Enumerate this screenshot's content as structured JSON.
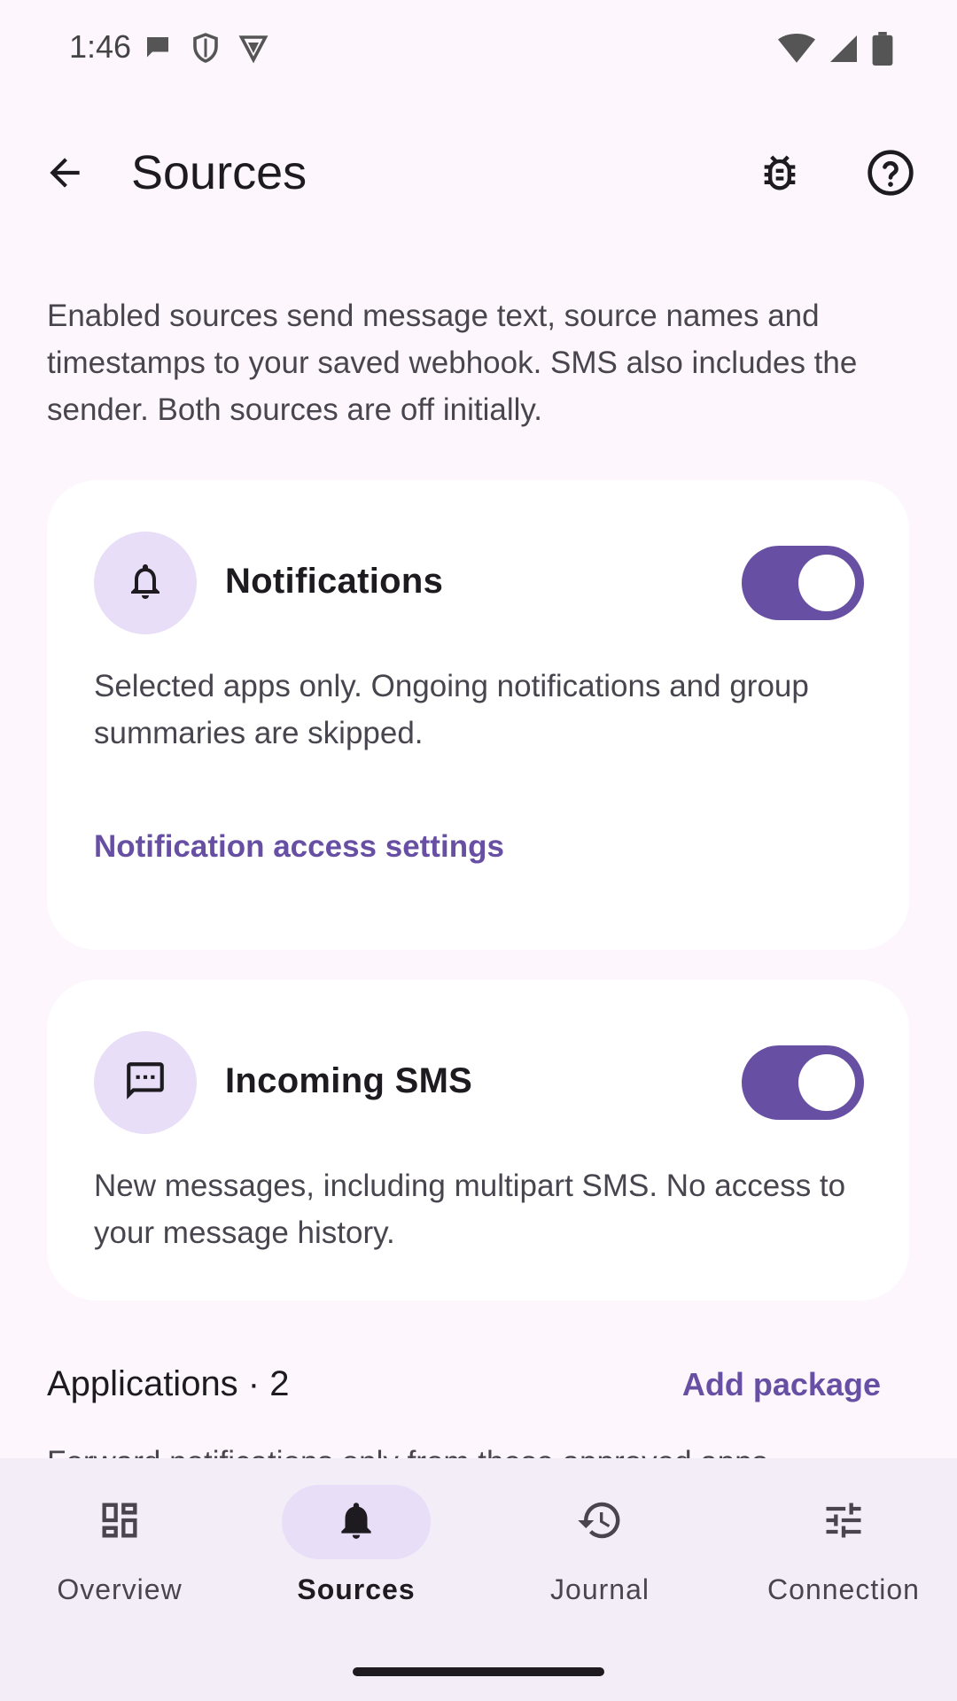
{
  "status_bar": {
    "time": "1:46",
    "icons_left": [
      "chat-bubble-icon",
      "shield-icon",
      "vpn-icon"
    ],
    "icons_right": [
      "wifi-icon",
      "signal-icon",
      "battery-icon"
    ]
  },
  "app_bar": {
    "title": "Sources",
    "back_icon": "arrow-back-icon",
    "actions": [
      "bug-icon",
      "help-icon"
    ]
  },
  "intro": "Enabled sources send message text, source names and timestamps to your saved webhook. SMS also includes the sender. Both sources are off initially.",
  "cards": {
    "notifications": {
      "title": "Notifications",
      "icon": "bell-icon",
      "enabled": true,
      "description": "Selected apps only. Ongoing notifications and group summaries are skipped.",
      "link": "Notification access settings"
    },
    "sms": {
      "title": "Incoming SMS",
      "icon": "sms-icon",
      "enabled": true,
      "description": "New messages, including multipart SMS. No access to your message history."
    }
  },
  "applications": {
    "title": "Applications · 2",
    "add_label": "Add package",
    "cut_text": "Forward notifications only from these approved apps."
  },
  "bottom_nav": {
    "items": [
      {
        "label": "Overview",
        "icon": "dashboard-icon",
        "active": false
      },
      {
        "label": "Sources",
        "icon": "bell-icon",
        "active": true
      },
      {
        "label": "Journal",
        "icon": "history-icon",
        "active": false
      },
      {
        "label": "Connection",
        "icon": "tune-icon",
        "active": false
      }
    ]
  },
  "colors": {
    "accent": "#6750a4",
    "accent_container": "#e8def8",
    "background": "#fdf7fd",
    "nav_background": "#f3edf7"
  }
}
